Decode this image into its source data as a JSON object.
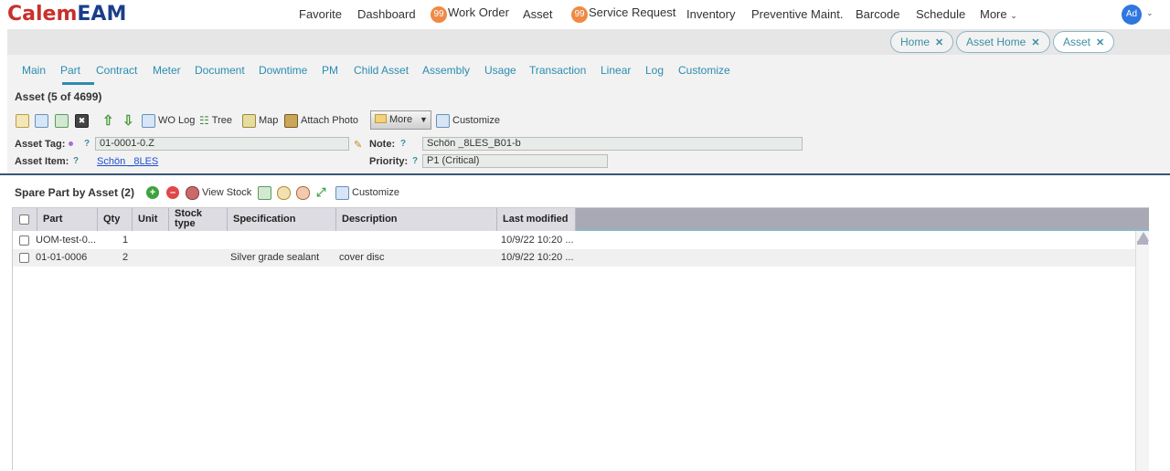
{
  "app": {
    "logo_part1": "Calem",
    "logo_part2": "EAM"
  },
  "nav": {
    "favorite": "Favorite",
    "dashboard": "Dashboard",
    "work_order_badge": "99",
    "work_order": "Work Order",
    "asset": "Asset",
    "service_request_badge": "99",
    "service_request": "Service Request",
    "inventory": "Inventory",
    "preventive": "Preventive Maint.",
    "barcode": "Barcode",
    "schedule": "Schedule",
    "more": "More",
    "avatar": "Ad"
  },
  "page_tabs": [
    {
      "label": "Home",
      "close": "✕"
    },
    {
      "label": "Asset Home",
      "close": "✕"
    },
    {
      "label": "Asset",
      "close": "✕"
    }
  ],
  "sub_tabs": [
    "Main",
    "Part",
    "Contract",
    "Meter",
    "Document",
    "Downtime",
    "PM",
    "Child Asset",
    "Assembly",
    "Usage",
    "Transaction",
    "Linear",
    "Log",
    "Customize"
  ],
  "asset_panel": {
    "title": "Asset (5 of 4699)",
    "toolbar": {
      "wo_log": "WO Log",
      "tree": "Tree",
      "map": "Map",
      "attach_photo": "Attach Photo",
      "more": "More",
      "customize": "Customize"
    },
    "asset_tag_label": "Asset Tag:",
    "asset_tag_value": "01-0001-0.Z",
    "note_label": "Note:",
    "note_value": "Schön _8LES_B01-b",
    "asset_item_label": "Asset Item:",
    "asset_item_value": "Schön _8LES",
    "priority_label": "Priority:",
    "priority_value": "P1 (Critical)",
    "help_mark": "?"
  },
  "spare_parts": {
    "title": "Spare Part by Asset (2)",
    "toolbar": {
      "view_stock": "View Stock",
      "customize": "Customize"
    },
    "columns": [
      "Part",
      "Qty",
      "Unit",
      "Stock type",
      "Specification",
      "Description",
      "Last modified"
    ],
    "rows": [
      {
        "part": "UOM-test-0...",
        "qty": "1",
        "unit": "",
        "stock_type": "",
        "specification": "",
        "description": "",
        "last_modified": "10/9/22 10:20 ..."
      },
      {
        "part": "01-01-0006",
        "qty": "2",
        "unit": "",
        "stock_type": "",
        "specification": "Silver grade sealant",
        "description": "cover disc",
        "last_modified": "10/9/22 10:20 ..."
      }
    ]
  },
  "colors": {
    "accent": "#2a8db0",
    "logo_red": "#c8302a",
    "logo_blue": "#1a3f8a",
    "badge": "#ee8a45",
    "divider": "#3a5575"
  }
}
